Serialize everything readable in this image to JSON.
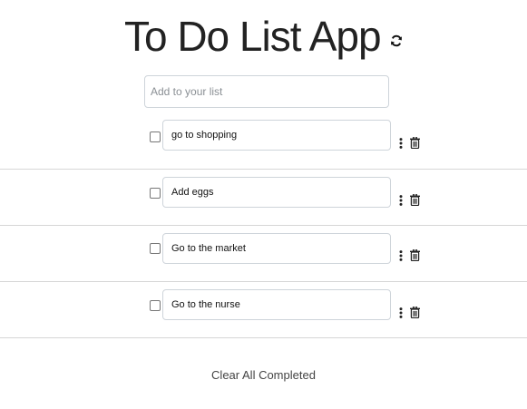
{
  "header": {
    "title": "To Do List App",
    "refresh_icon": "refresh-icon"
  },
  "add_item": {
    "placeholder": "Add to your list",
    "value": ""
  },
  "todos": [
    {
      "text": "go to shopping",
      "checked": false
    },
    {
      "text": "Add eggs",
      "checked": false
    },
    {
      "text": "Go to the market",
      "checked": false
    },
    {
      "text": "Go to the nurse",
      "checked": false
    }
  ],
  "icons": {
    "options": "kebab-vertical-icon",
    "delete": "trash-icon"
  },
  "footer": {
    "clear_label": "Clear All Completed"
  },
  "colors": {
    "text": "#222222",
    "border": "#ced4da",
    "divider": "#d6d6d6"
  }
}
